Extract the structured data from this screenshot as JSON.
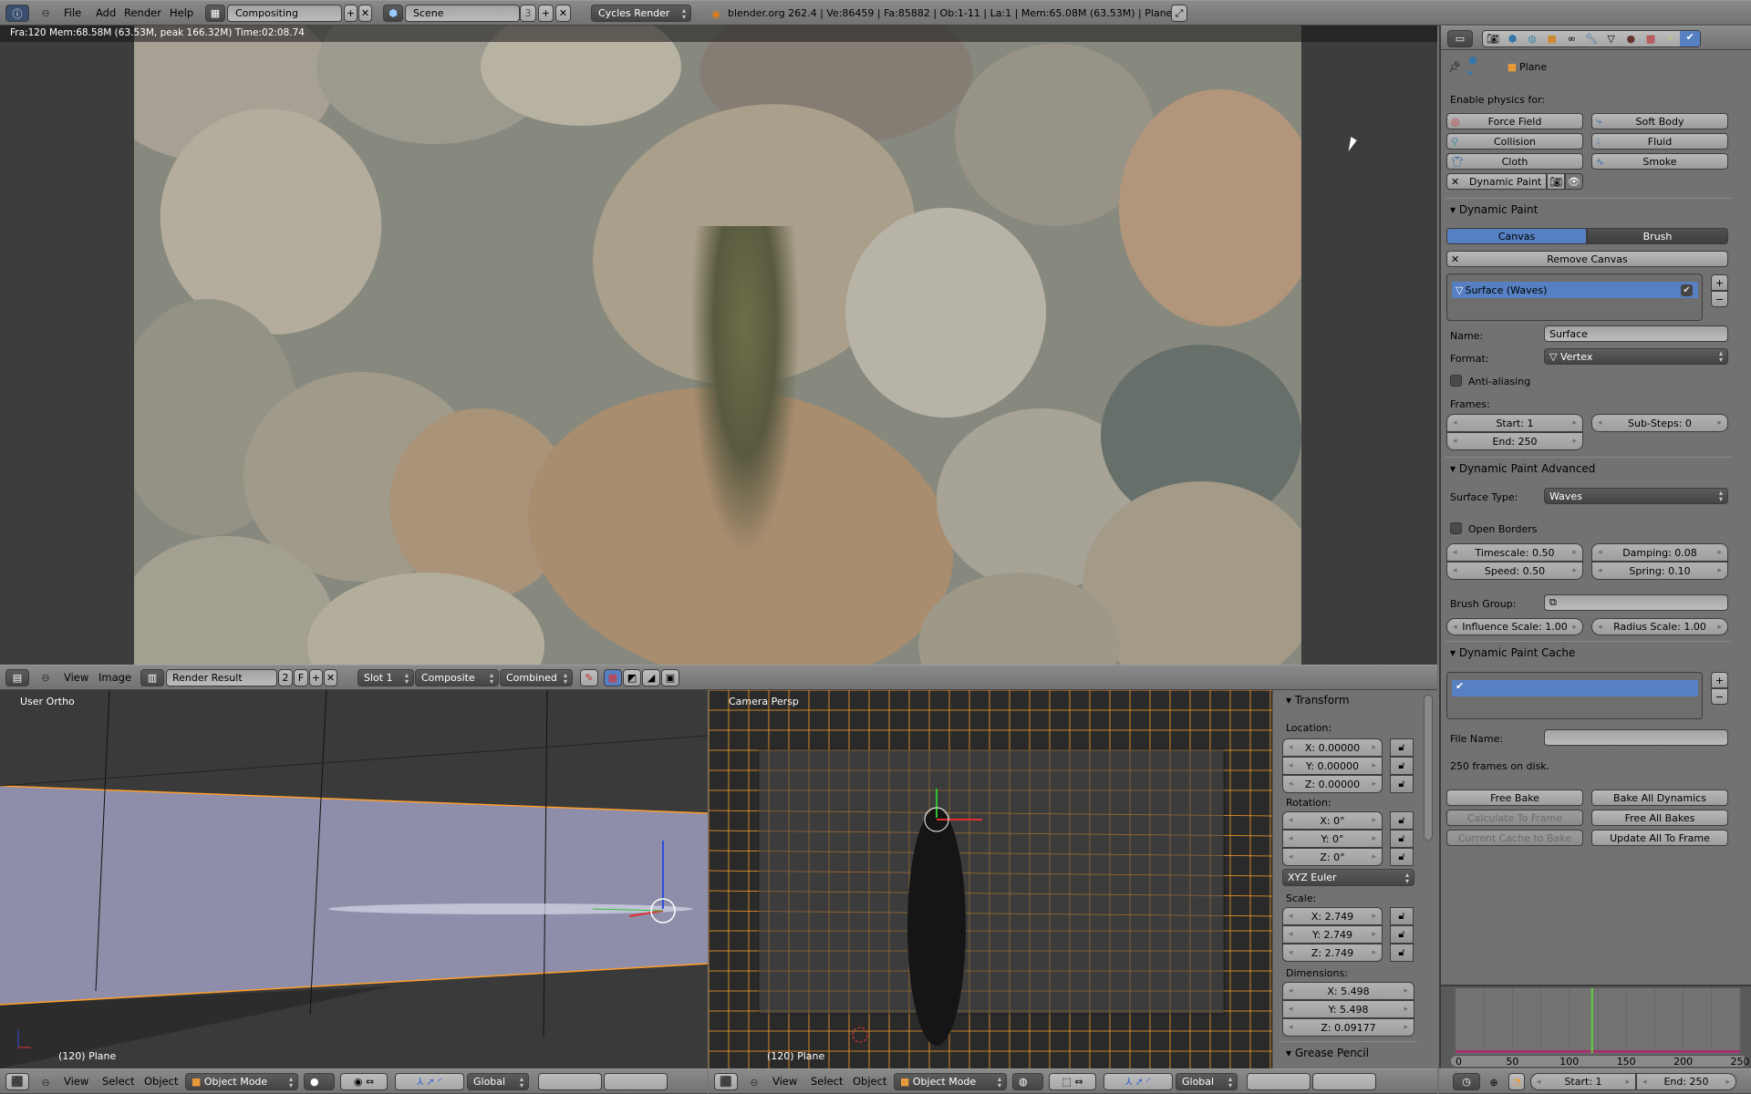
{
  "topbar": {
    "menus": [
      "File",
      "Add",
      "Render",
      "Help"
    ],
    "screen_layout": "Compositing",
    "scene": "Scene",
    "scene_users": "3",
    "render_engine": "Cycles Render",
    "stats": "blender.org 262.4 | Ve:86459 | Fa:85882 | Ob:1-11 | La:1 | Mem:65.08M (63.53M) | Plane"
  },
  "image_editor": {
    "render_info": "Fra:120  Mem:68.58M (63.53M, peak 166.32M) Time:02:08.74",
    "header": {
      "menus": [
        "View",
        "Image"
      ],
      "image_name": "Render Result",
      "users": "2",
      "fake_user": "F",
      "slot": "Slot 1",
      "layer": "Composite",
      "pass": "Combined"
    }
  },
  "viewport_left": {
    "view_label": "User Ortho",
    "object_label": "(120) Plane",
    "header": {
      "menus": [
        "View",
        "Select",
        "Object"
      ],
      "mode": "Object Mode",
      "orientation": "Global"
    }
  },
  "viewport_right": {
    "view_label": "Camera Persp",
    "object_label": "(120) Plane",
    "header": {
      "menus": [
        "View",
        "Select",
        "Object"
      ],
      "mode": "Object Mode",
      "orientation": "Global"
    },
    "transform_panel": {
      "title": "Transform",
      "location_label": "Location:",
      "location": [
        "X: 0.00000",
        "Y: 0.00000",
        "Z: 0.00000"
      ],
      "rotation_label": "Rotation:",
      "rotation": [
        "X: 0°",
        "Y: 0°",
        "Z: 0°"
      ],
      "rotation_mode": "XYZ Euler",
      "scale_label": "Scale:",
      "scale": [
        "X: 2.749",
        "Y: 2.749",
        "Z: 2.749"
      ],
      "dimensions_label": "Dimensions:",
      "dimensions": [
        "X: 5.498",
        "Y: 5.498",
        "Z: 0.09177"
      ],
      "grease_pencil": "Grease Pencil"
    }
  },
  "properties": {
    "context_object": "Plane",
    "enable_physics_label": "Enable physics for:",
    "physics_buttons": [
      "Force Field",
      "Soft Body",
      "Collision",
      "Fluid",
      "Cloth",
      "Smoke"
    ],
    "dynamic_paint_button": "Dynamic Paint",
    "dynamic_paint": {
      "title": "Dynamic Paint",
      "tabs": [
        "Canvas",
        "Brush"
      ],
      "active_tab": "Canvas",
      "remove_canvas": "Remove Canvas",
      "surfaces": [
        {
          "name": "Surface (Waves)",
          "enabled": true
        }
      ],
      "name_label": "Name:",
      "name_value": "Surface",
      "format_label": "Format:",
      "format_value": "Vertex",
      "anti_aliasing": "Anti-aliasing",
      "anti_aliasing_checked": false,
      "frames_label": "Frames:",
      "start": "Start: 1",
      "end": "End: 250",
      "substeps": "Sub-Steps: 0"
    },
    "advanced": {
      "title": "Dynamic Paint Advanced",
      "surface_type_label": "Surface Type:",
      "surface_type": "Waves",
      "open_borders": "Open Borders",
      "open_borders_checked": false,
      "timescale": "Timescale: 0.50",
      "speed": "Speed: 0.50",
      "damping": "Damping: 0.08",
      "spring": "Spring: 0.10",
      "brush_group_label": "Brush Group:",
      "influence_scale": "Influence Scale: 1.00",
      "radius_scale": "Radius Scale: 1.00"
    },
    "cache": {
      "title": "Dynamic Paint Cache",
      "file_name_label": "File Name:",
      "file_name": "",
      "frames_info": "250 frames on disk.",
      "buttons": [
        "Free Bake",
        "Bake All Dynamics",
        "Calculate To Frame",
        "Free All Bakes",
        "Current Cache to Bake",
        "Update All To Frame"
      ],
      "disabled_buttons": [
        "Calculate To Frame",
        "Current Cache to Bake"
      ]
    }
  },
  "timeline": {
    "ticks": [
      "0",
      "50",
      "100",
      "150",
      "200",
      "250"
    ],
    "current_frame": 120,
    "range": [
      0,
      250
    ],
    "start": "Start: 1",
    "end": "End: 250",
    "colors": {
      "playhead": "#5fd13a",
      "range_bar": "#a0306a"
    }
  },
  "colors": {
    "accent": "#5680c2",
    "wire": "#ff9f2a"
  }
}
